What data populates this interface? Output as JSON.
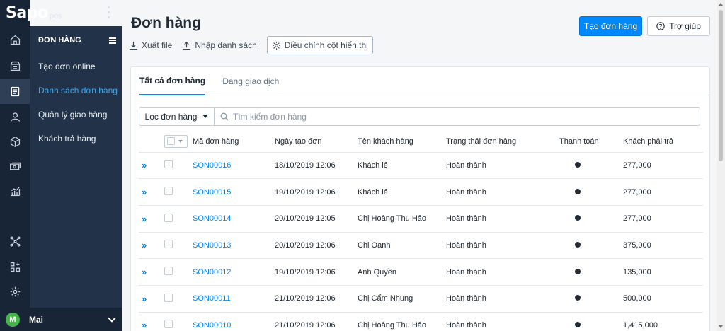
{
  "app": {
    "logo_main": "Sapo",
    "logo_sub": "pos"
  },
  "rail": {
    "icons": [
      "home-icon",
      "store-icon",
      "orders-icon",
      "customer-icon",
      "product-icon",
      "cash-icon",
      "report-icon",
      "integration-icon",
      "apps-icon",
      "settings-icon"
    ],
    "active": "orders-icon"
  },
  "subnav": {
    "header": "ĐƠN HÀNG",
    "items": [
      {
        "label": "Tạo đơn online"
      },
      {
        "label": "Danh sách đơn hàng"
      },
      {
        "label": "Quản lý giao hàng"
      },
      {
        "label": "Khách trả hàng"
      }
    ],
    "active_index": 1
  },
  "user": {
    "initial": "M",
    "name": "Mai"
  },
  "page": {
    "title": "Đơn hàng",
    "actions": {
      "export": "Xuất file",
      "import": "Nhập danh sách",
      "columns": "Điều chỉnh cột hiển thị"
    },
    "create_button": "Tạo đơn hàng",
    "help_button": "Trợ giúp"
  },
  "tabs": [
    {
      "label": "Tất cả đơn hàng"
    },
    {
      "label": "Đang giao dịch"
    }
  ],
  "filter": {
    "button": "Lọc đơn hàng",
    "search_placeholder": "Tìm kiếm đơn hàng"
  },
  "table": {
    "headers": {
      "code": "Mã đơn hàng",
      "date": "Ngày tạo đơn",
      "customer": "Tên khách hàng",
      "status": "Trạng thái đơn hàng",
      "payment": "Thanh toán",
      "due": "Khách phải trả"
    },
    "rows": [
      {
        "code": "SON00016",
        "date": "18/10/2019 12:06",
        "customer": "Khách lẻ",
        "status": "Hoàn thành",
        "due": "277,000"
      },
      {
        "code": "SON00015",
        "date": "19/10/2019 12:06",
        "customer": "Khách lẻ",
        "status": "Hoàn thành",
        "due": "277,000"
      },
      {
        "code": "SON00014",
        "date": "20/10/2019 12:05",
        "customer": "Chị Hoàng Thu Hảo",
        "status": "Hoàn thành",
        "due": "277,000"
      },
      {
        "code": "SON00013",
        "date": "20/10/2019 12:06",
        "customer": "Chi Oanh",
        "status": "Hoàn thành",
        "due": "375,000"
      },
      {
        "code": "SON00012",
        "date": "19/10/2019 12:06",
        "customer": "Anh Quyền",
        "status": "Hoàn thành",
        "due": "135,000"
      },
      {
        "code": "SON00011",
        "date": "21/10/2019 12:06",
        "customer": "Chị Cẩm Nhung",
        "status": "Hoàn thành",
        "due": "500,000"
      },
      {
        "code": "SON00010",
        "date": "21/10/2019 12:06",
        "customer": "Chị Hoàng Thu Hảo",
        "status": "Hoàn thành",
        "due": "1,415,000"
      }
    ]
  },
  "colors": {
    "accent": "#0088ff",
    "sidebar_dark": "#182537",
    "sidebar": "#223249",
    "active_link": "#3fa6e8"
  }
}
